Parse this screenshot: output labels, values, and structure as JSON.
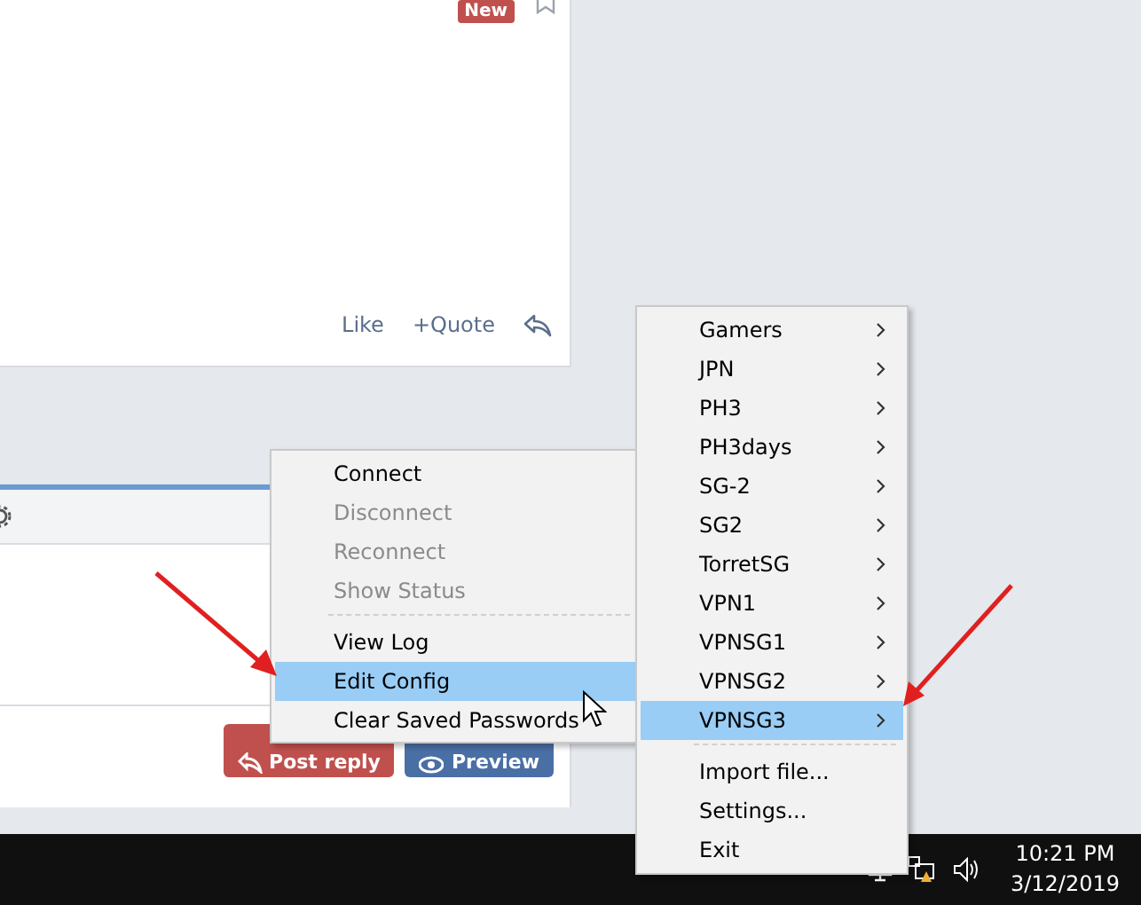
{
  "post": {
    "badge": "New",
    "actions": [
      {
        "kind": "text",
        "label": "Like"
      },
      {
        "kind": "text",
        "label": "+Quote"
      },
      {
        "kind": "reply"
      }
    ]
  },
  "editor": {
    "buttons": [
      {
        "kind": "primary",
        "label": "Post reply"
      },
      {
        "kind": "secondary",
        "label": "Preview"
      }
    ]
  },
  "context_menu": {
    "items": [
      {
        "kind": "item",
        "label": "Connect",
        "disabled": false,
        "selected": false
      },
      {
        "kind": "item",
        "label": "Disconnect",
        "disabled": true,
        "selected": false
      },
      {
        "kind": "item",
        "label": "Reconnect",
        "disabled": true,
        "selected": false
      },
      {
        "kind": "item",
        "label": "Show Status",
        "disabled": true,
        "selected": false
      },
      {
        "kind": "separator"
      },
      {
        "kind": "item",
        "label": "View Log",
        "disabled": false,
        "selected": false
      },
      {
        "kind": "item",
        "label": "Edit Config",
        "disabled": false,
        "selected": true
      },
      {
        "kind": "item",
        "label": "Clear Saved Passwords",
        "disabled": false,
        "selected": false
      }
    ]
  },
  "tray_menu": {
    "items": [
      {
        "kind": "submenu",
        "label": "Gamers",
        "selected": false
      },
      {
        "kind": "submenu",
        "label": "JPN",
        "selected": false
      },
      {
        "kind": "submenu",
        "label": "PH3",
        "selected": false
      },
      {
        "kind": "submenu",
        "label": "PH3days",
        "selected": false
      },
      {
        "kind": "submenu",
        "label": "SG-2",
        "selected": false
      },
      {
        "kind": "submenu",
        "label": "SG2",
        "selected": false
      },
      {
        "kind": "submenu",
        "label": "TorretSG",
        "selected": false
      },
      {
        "kind": "submenu",
        "label": "VPN1",
        "selected": false
      },
      {
        "kind": "submenu",
        "label": "VPNSG1",
        "selected": false
      },
      {
        "kind": "submenu",
        "label": "VPNSG2",
        "selected": false
      },
      {
        "kind": "submenu",
        "label": "VPNSG3",
        "selected": true
      },
      {
        "kind": "separator"
      },
      {
        "kind": "item",
        "label": "Import file...",
        "selected": false
      },
      {
        "kind": "item",
        "label": "Settings...",
        "selected": false
      },
      {
        "kind": "item",
        "label": "Exit",
        "selected": false
      }
    ]
  },
  "taskbar": {
    "time": "10:21 PM",
    "date": "3/12/2019"
  }
}
